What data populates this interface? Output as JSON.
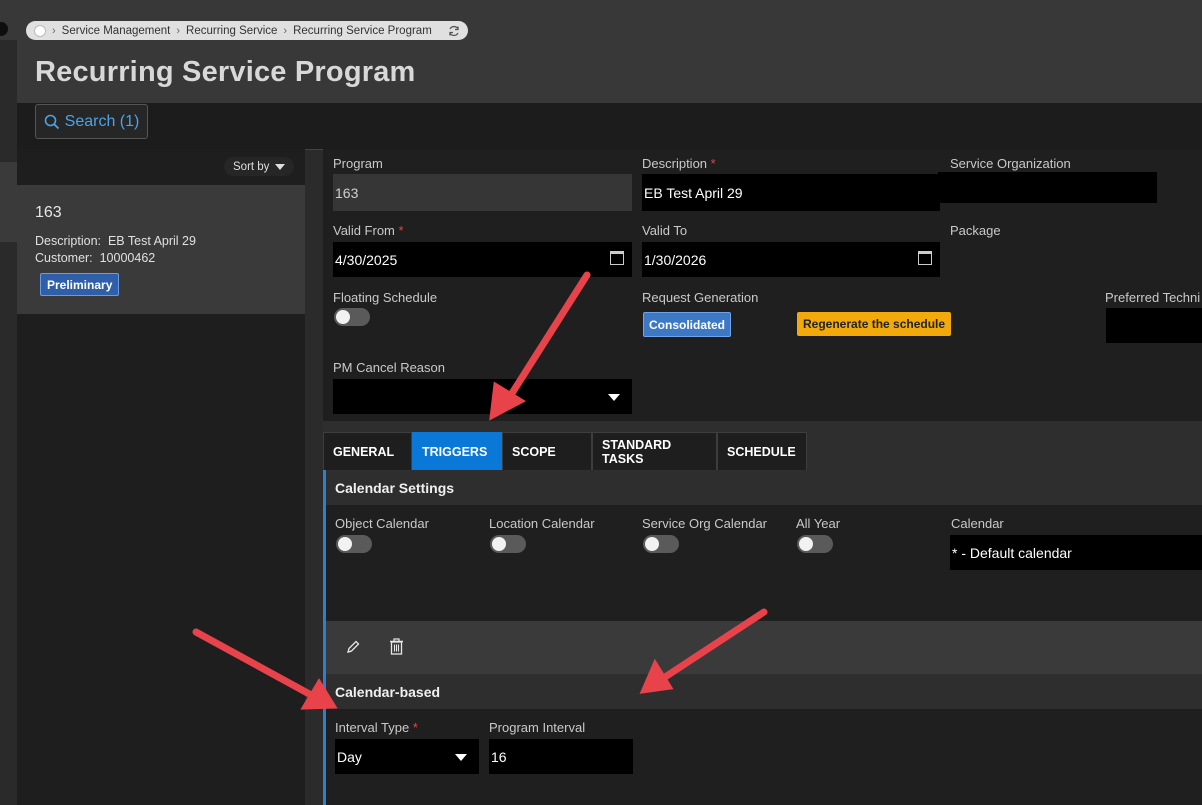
{
  "breadcrumb": {
    "items": [
      "Service Management",
      "Recurring Service",
      "Recurring Service Program"
    ]
  },
  "page_title": "Recurring Service Program",
  "toolbar": {
    "search_label": "Search (1)"
  },
  "list": {
    "sort_label": "Sort by",
    "card": {
      "id": "163",
      "description_label": "Description:",
      "description_value": "EB Test April 29",
      "customer_label": "Customer:",
      "customer_value": "10000462",
      "status_badge": "Preliminary"
    }
  },
  "form": {
    "program_label": "Program",
    "program_value": "163",
    "description_label": "Description",
    "description_value": "EB Test April 29",
    "service_org_label": "Service Organization",
    "valid_from_label": "Valid From",
    "valid_from_value": "4/30/2025",
    "valid_to_label": "Valid To",
    "valid_to_value": "1/30/2026",
    "package_label": "Package",
    "floating_schedule_label": "Floating Schedule",
    "request_generation_label": "Request Generation",
    "request_generation_value": "Consolidated",
    "regenerate_label": "Regenerate the schedule",
    "preferred_tech_label": "Preferred Techni",
    "pm_cancel_reason_label": "PM Cancel Reason",
    "required_mark": "*"
  },
  "tabs": [
    {
      "label": "GENERAL",
      "active": false
    },
    {
      "label": "TRIGGERS",
      "active": true
    },
    {
      "label": "SCOPE",
      "active": false
    },
    {
      "label": "STANDARD TASKS",
      "active": false
    },
    {
      "label": "SCHEDULE",
      "active": false
    }
  ],
  "calendar_settings": {
    "title": "Calendar Settings",
    "object_calendar_label": "Object Calendar",
    "location_calendar_label": "Location Calendar",
    "service_org_calendar_label": "Service Org Calendar",
    "all_year_label": "All Year",
    "calendar_label": "Calendar",
    "calendar_value": "* - Default calendar"
  },
  "calendar_based": {
    "title": "Calendar-based",
    "interval_type_label": "Interval Type",
    "interval_type_value": "Day",
    "program_interval_label": "Program Interval",
    "program_interval_value": "16"
  },
  "colors": {
    "accent_blue": "#0a78d6",
    "annotation_red": "#e8434a",
    "badge_amber": "#f1a90c",
    "required_red": "#e64545"
  },
  "icons": {
    "search": "search-icon",
    "edit": "pencil-icon",
    "delete": "trash-icon",
    "calendar": "calendar-icon",
    "refresh": "refresh-icon"
  }
}
